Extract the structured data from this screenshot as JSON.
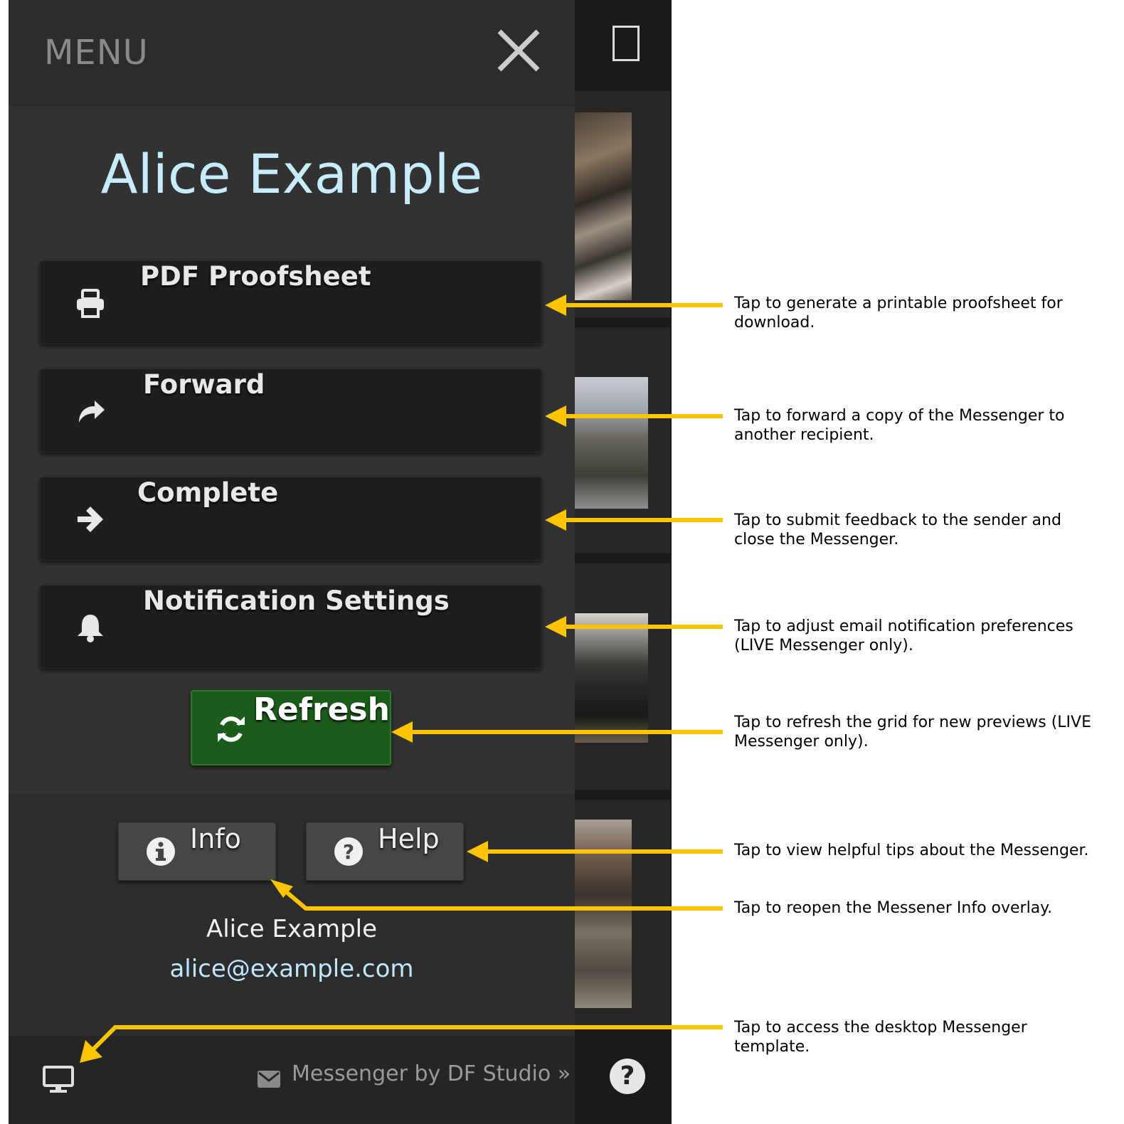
{
  "menu": {
    "header_label": "MENU",
    "title": "Alice Example",
    "buttons": [
      {
        "label": "PDF Proofsheet",
        "icon": "printer-icon"
      },
      {
        "label": "Forward",
        "icon": "share-arrow-icon"
      },
      {
        "label": "Complete",
        "icon": "arrow-right-icon"
      },
      {
        "label": "Notification Settings",
        "icon": "bell-icon"
      }
    ],
    "refresh_label": "Refresh",
    "info_label": "Info",
    "help_label": "Help",
    "user_name": "Alice Example",
    "user_email": "alice@example.com",
    "footer_text": "Messenger by DF Studio »"
  },
  "colors": {
    "panel_bg": "#323232",
    "title_color": "#c7ecff",
    "refresh_bg": "#1b5c1b",
    "annotation_arrow": "#ffc400"
  },
  "annotations": [
    {
      "text": "Tap to generate a printable proofsheet for download."
    },
    {
      "text": "Tap to forward a copy of the Messenger to another recipient."
    },
    {
      "text": "Tap to submit feedback to the sender and close the Messenger."
    },
    {
      "text": "Tap to adjust email notification preferences (LIVE Messenger only)."
    },
    {
      "text": "Tap to refresh the grid for new previews (LIVE Messenger only)."
    },
    {
      "text": "Tap to view helpful tips about the Messenger."
    },
    {
      "text": "Tap to reopen the Messener Info overlay."
    },
    {
      "text": "Tap to access the desktop Messenger template."
    }
  ]
}
